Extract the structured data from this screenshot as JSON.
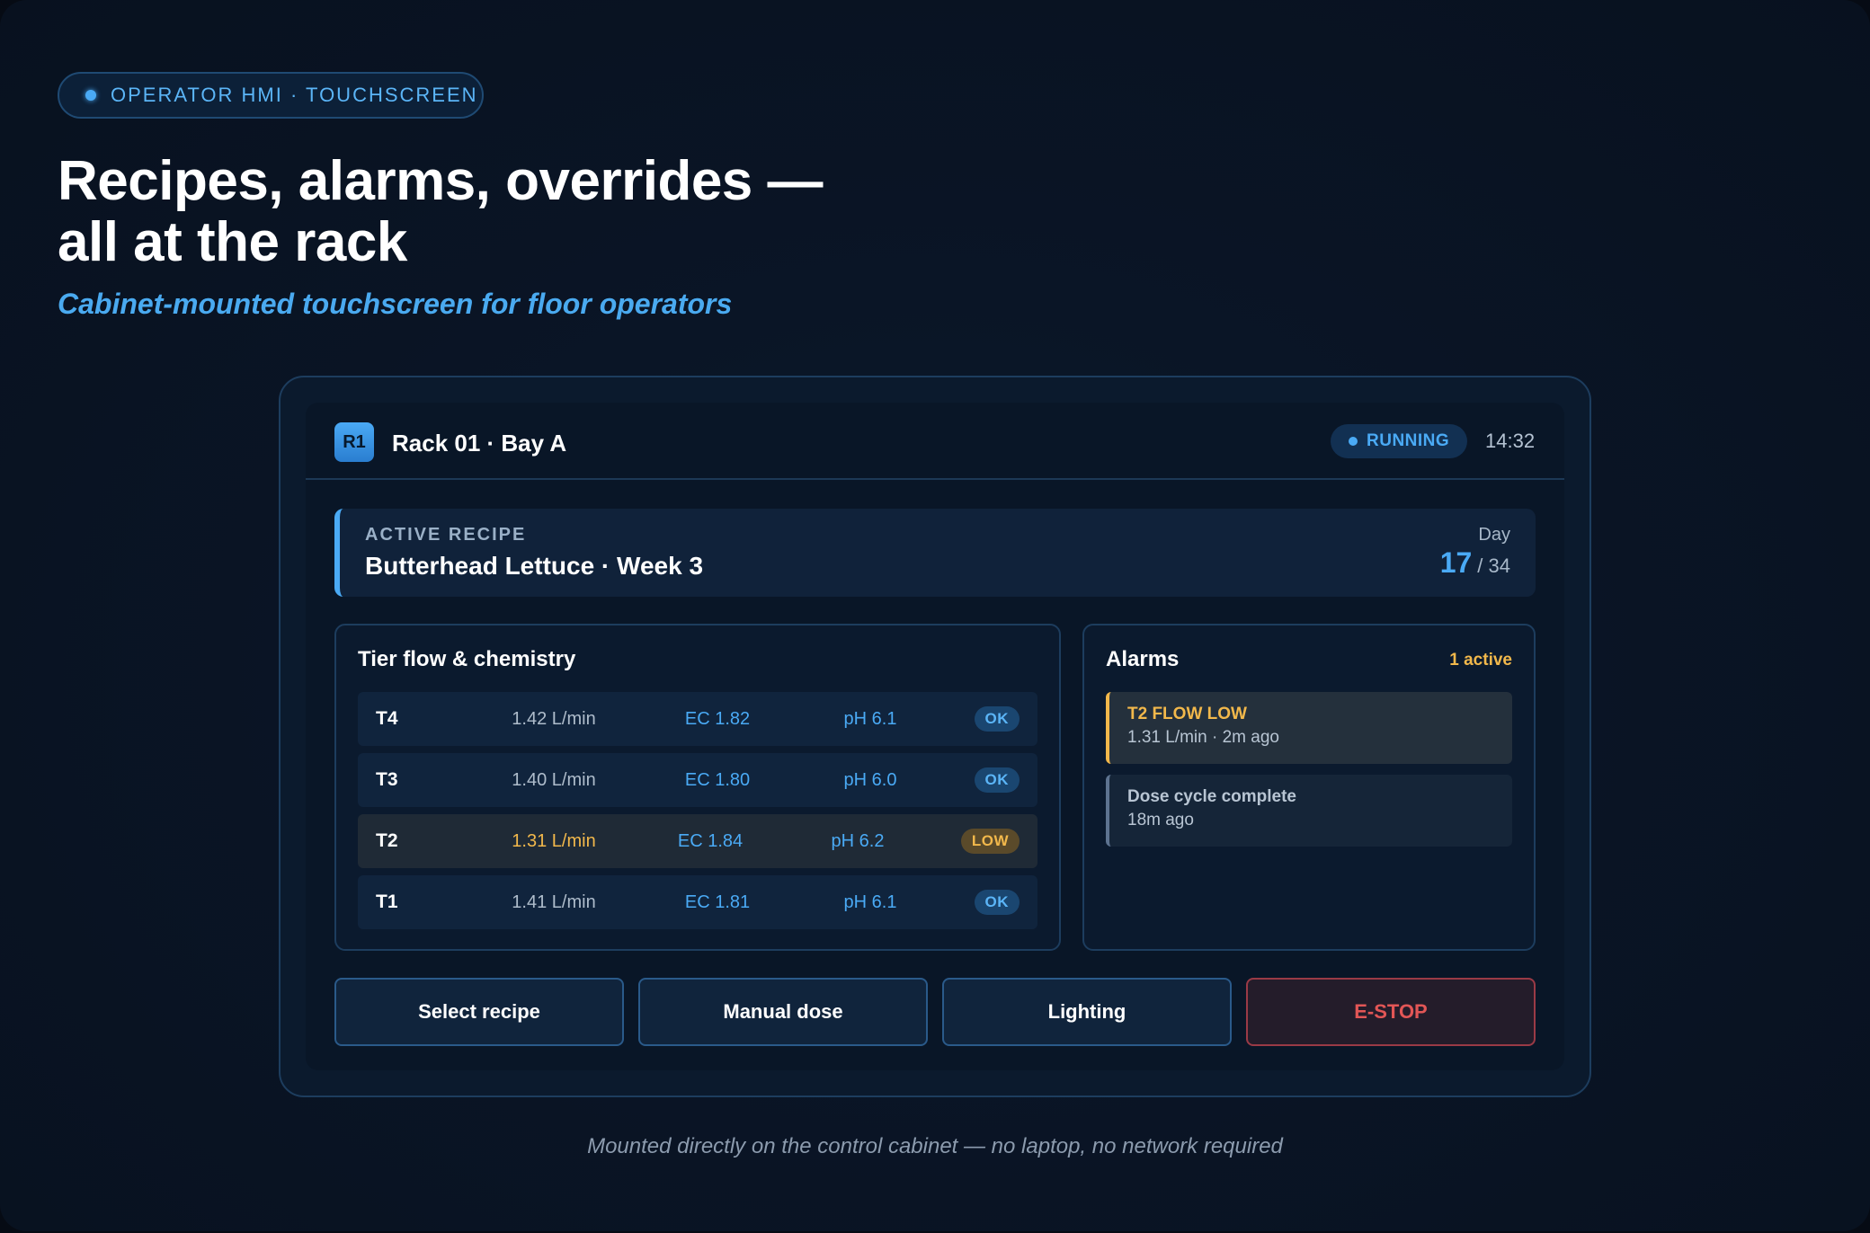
{
  "eyebrow": {
    "label": "OPERATOR HMI · TOUCHSCREEN"
  },
  "headline": {
    "line1": "Recipes, alarms, overrides —",
    "line2": "all at the rack"
  },
  "subhead": "Cabinet-mounted touchscreen for floor operators",
  "hmi": {
    "rack_badge": "R1",
    "rack_title": "Rack 01 · Bay A",
    "status": "RUNNING",
    "clock": "14:32",
    "recipe": {
      "label": "ACTIVE RECIPE",
      "name": "Butterhead Lettuce · Week 3",
      "day_label": "Day",
      "day_current": "17",
      "day_total": "/ 34"
    },
    "tiers_panel": {
      "title": "Tier flow & chemistry",
      "rows": [
        {
          "id": "T4",
          "flow": "1.42 L/min",
          "ec": "EC 1.82",
          "ph": "pH 6.1",
          "status": "OK"
        },
        {
          "id": "T3",
          "flow": "1.40 L/min",
          "ec": "EC 1.80",
          "ph": "pH 6.0",
          "status": "OK"
        },
        {
          "id": "T2",
          "flow": "1.31 L/min",
          "ec": "EC 1.84",
          "ph": "pH 6.2",
          "status": "LOW"
        },
        {
          "id": "T1",
          "flow": "1.41 L/min",
          "ec": "EC 1.81",
          "ph": "pH 6.1",
          "status": "OK"
        }
      ]
    },
    "alarms_panel": {
      "title": "Alarms",
      "count": "1 active",
      "items": [
        {
          "title": "T2 FLOW LOW",
          "detail": "1.31 L/min · 2m ago"
        },
        {
          "title": "Dose cycle complete",
          "detail": "18m ago"
        }
      ]
    },
    "buttons": {
      "select_recipe": "Select recipe",
      "manual_dose": "Manual dose",
      "lighting": "Lighting",
      "estop": "E-STOP"
    }
  },
  "footnote": "Mounted directly on the control cabinet — no laptop, no network required",
  "colors": {
    "accent": "#4aaaf5",
    "warning": "#f2b84b",
    "danger": "#e25656",
    "background": "#08111f"
  }
}
